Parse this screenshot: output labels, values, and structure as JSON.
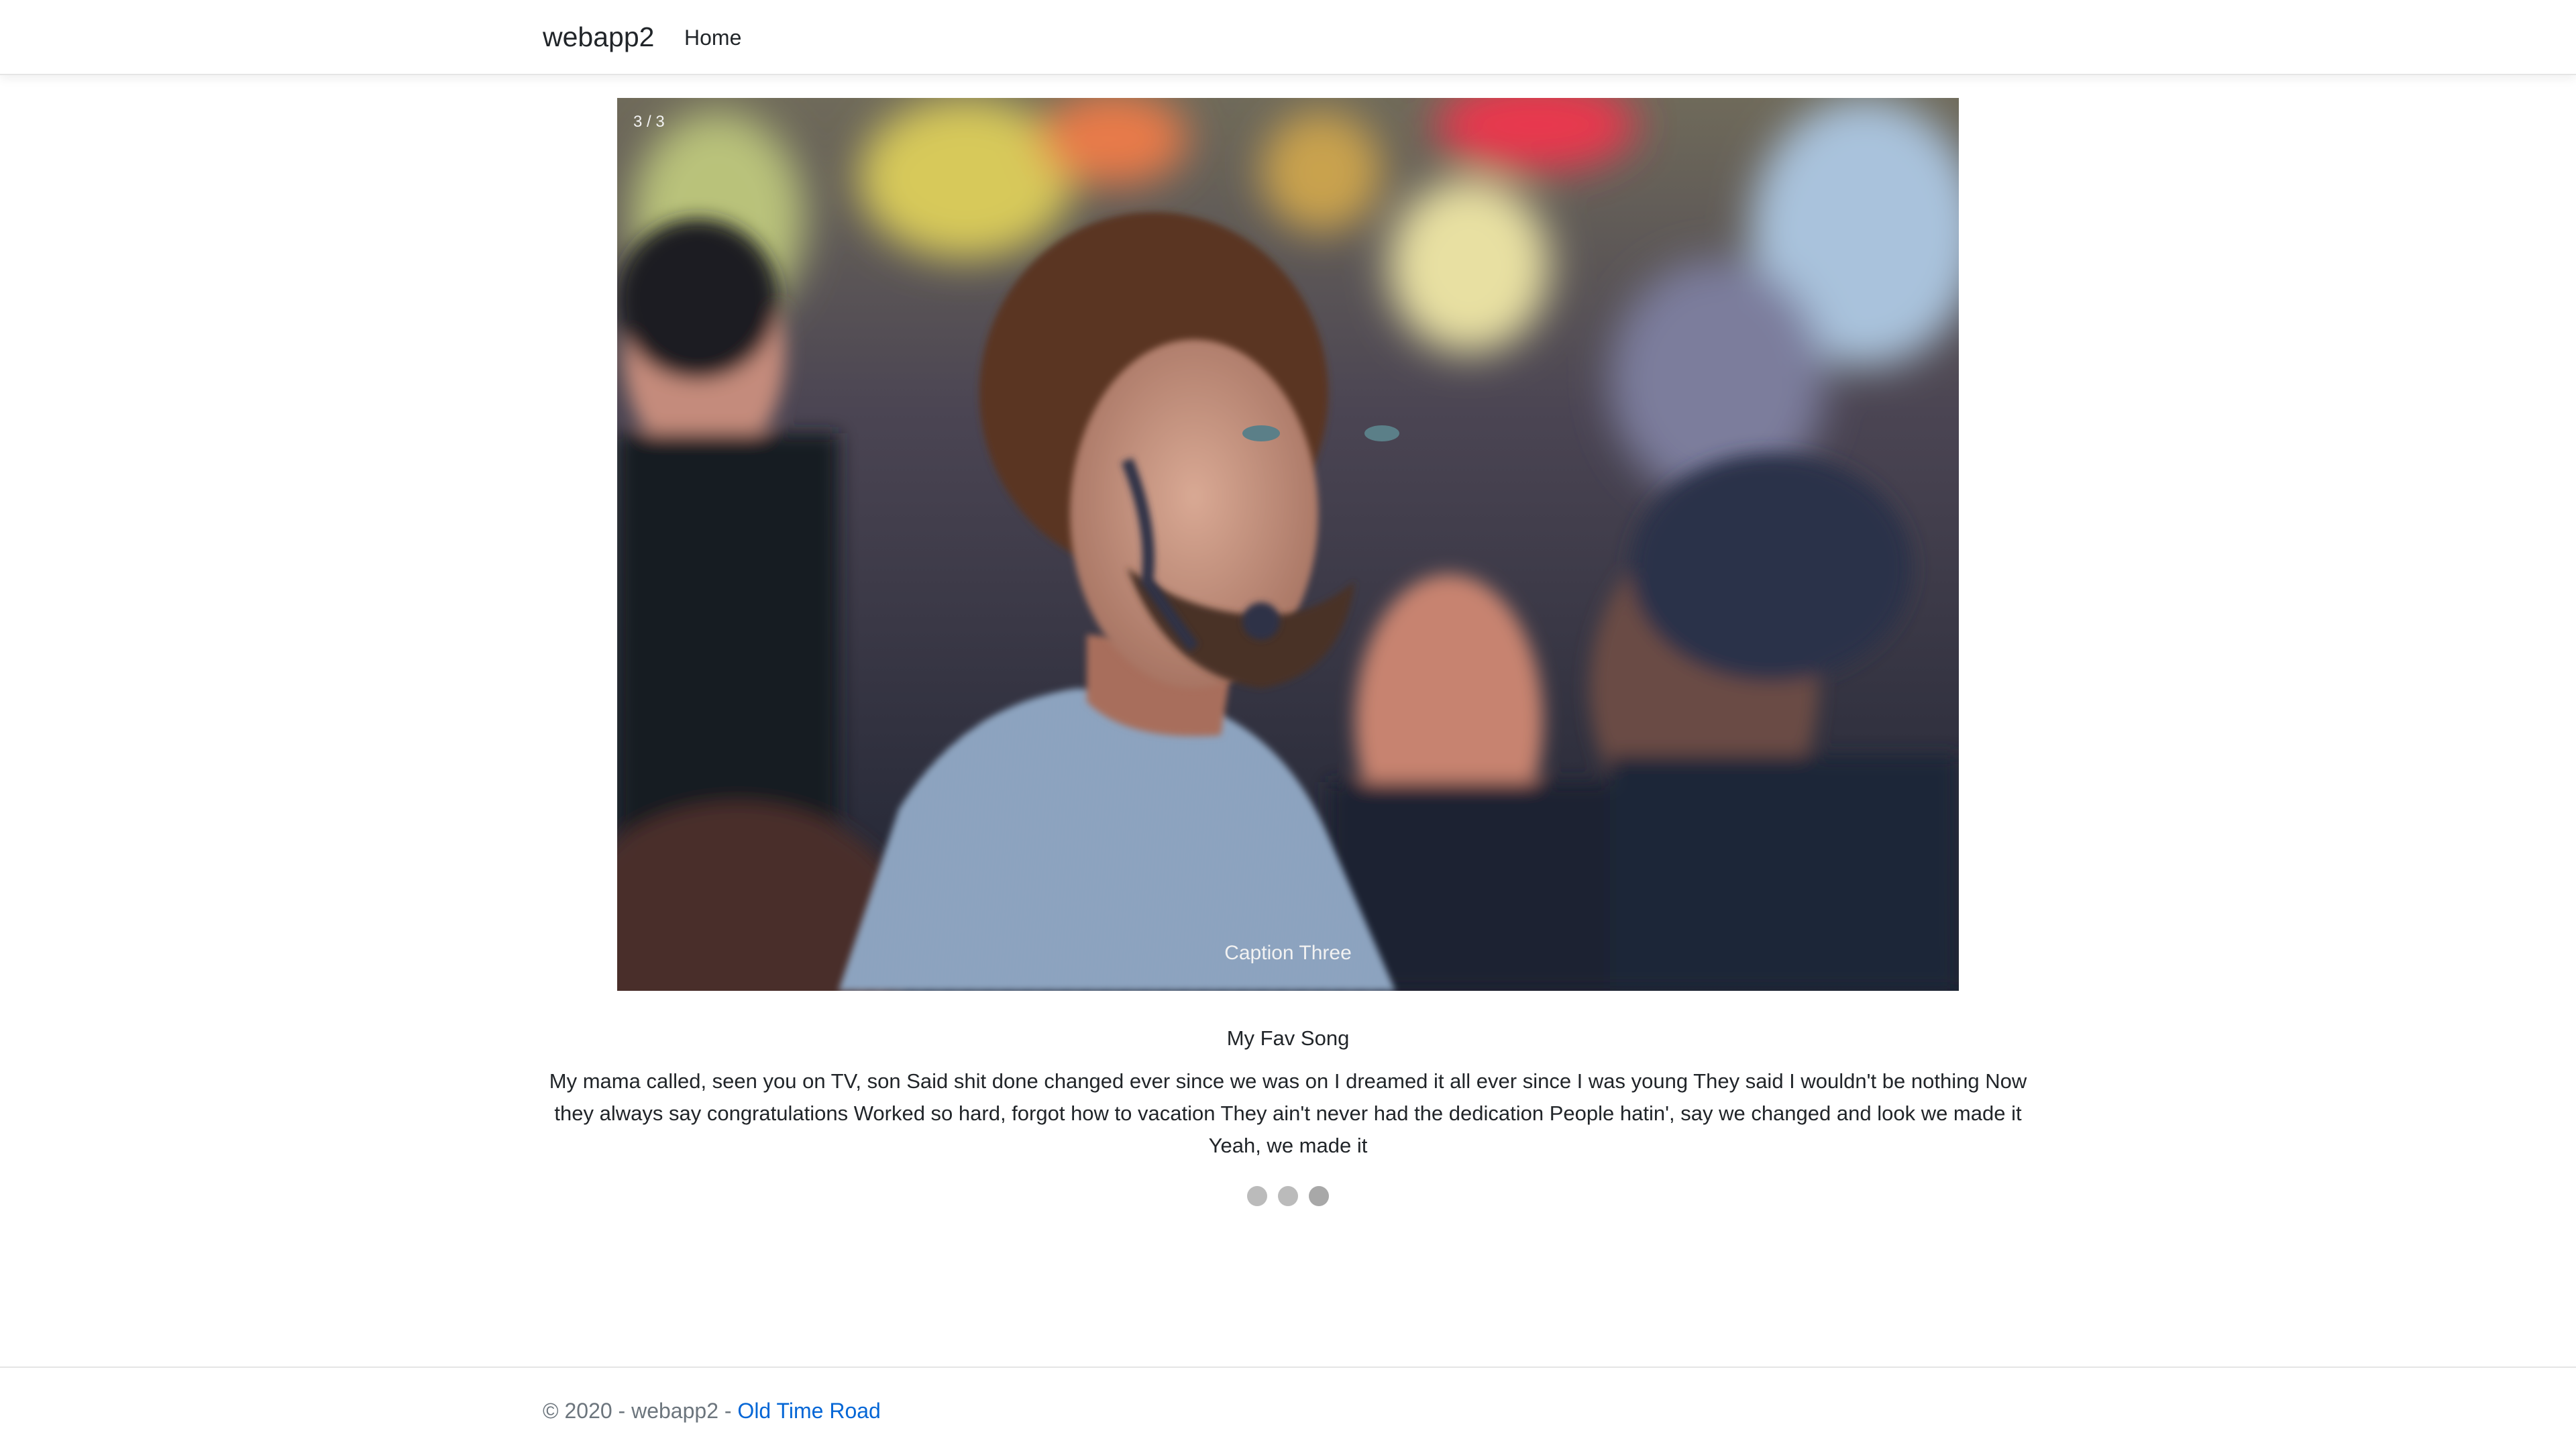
{
  "navbar": {
    "brand": "webapp2",
    "home_label": "Home"
  },
  "slideshow": {
    "number_text": "3 / 3",
    "caption": "Caption Three",
    "image_subject": "photo-of-man-with-curly-hair-and-face-tattoos-in-crowd",
    "dots": [
      {
        "index": 1,
        "active": false
      },
      {
        "index": 2,
        "active": false
      },
      {
        "index": 3,
        "active": true
      }
    ]
  },
  "song": {
    "title": "My Fav Song",
    "lyrics": "My mama called, seen you on TV, son Said shit done changed ever since we was on I dreamed it all ever since I was young They said I wouldn't be nothing Now they always say congratulations Worked so hard, forgot how to vacation They ain't never had the dedication People hatin', say we changed and look we made it Yeah, we made it"
  },
  "footer": {
    "copyright": "© 2020 - webapp2 - ",
    "link_label": "Old Time Road"
  },
  "colors": {
    "link": "#0366d6",
    "footer_text": "#6c757d",
    "dot": "#bbbbbb",
    "caption_text": "#f2f2f2"
  }
}
